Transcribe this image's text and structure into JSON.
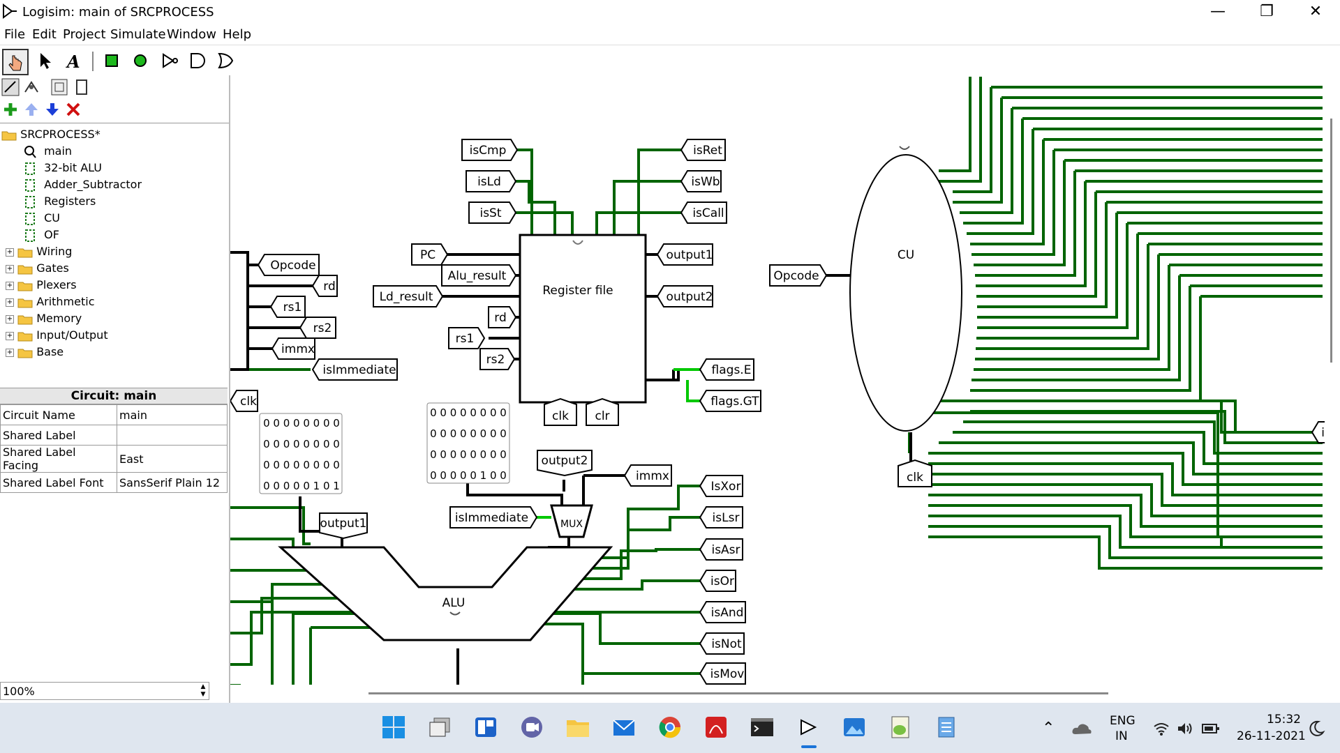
{
  "window": {
    "title": "Logisim: main of SRCPROCESS"
  },
  "menu": [
    "File",
    "Edit",
    "Project",
    "Simulate",
    "Window",
    "Help"
  ],
  "tree": {
    "root": "SRCPROCESS*",
    "circuits": [
      "main",
      "32-bit ALU",
      "Adder_Subtractor",
      "Registers",
      "CU",
      "OF"
    ],
    "libraries": [
      "Wiring",
      "Gates",
      "Plexers",
      "Arithmetic",
      "Memory",
      "Input/Output",
      "Base"
    ]
  },
  "properties": {
    "header": "Circuit: main",
    "rows": [
      {
        "name": "Circuit Name",
        "value": "main"
      },
      {
        "name": "Shared Label",
        "value": ""
      },
      {
        "name": "Shared Label Facing",
        "value": "East"
      },
      {
        "name": "Shared Label Font",
        "value": "SansSerif Plain 12"
      }
    ]
  },
  "zoom": "100%",
  "circuit": {
    "tunnels": [
      "isCmp",
      "isLd",
      "isSt",
      "isRet",
      "isWb",
      "isCall",
      "PC",
      "Alu_result",
      "Ld_result",
      "rd",
      "rs1",
      "rs2",
      "output1",
      "output2",
      "flags.E",
      "flags.GT",
      "clk",
      "clr",
      "Opcode",
      "immx",
      "isImmediate",
      "IsXor",
      "isLsr",
      "isAsr",
      "isOr",
      "isAnd",
      "isNot",
      "isMov",
      "is"
    ],
    "blocks": {
      "register_file": "Register file",
      "cu": "CU",
      "alu": "ALU",
      "mux": "MUX"
    },
    "constants": [
      [
        "0 0 0 0 0 0 0 0",
        "0 0 0 0 0 0 0 0",
        "0 0 0 0 0 0 0 0",
        "0 0 0 0 0 1 0 1"
      ],
      [
        "0 0 0 0 0 0 0 0",
        "0 0 0 0 0 0 0 0",
        "0 0 0 0 0 0 0 0",
        "0 0 0 0 0 1 0 0"
      ]
    ]
  },
  "tray": {
    "lang1": "ENG",
    "lang2": "IN",
    "time": "15:32",
    "date": "26-11-2021"
  },
  "colors": {
    "wire_dark": "#006400",
    "wire_bright": "#00c800",
    "taskbar": "#dfe6ef"
  }
}
